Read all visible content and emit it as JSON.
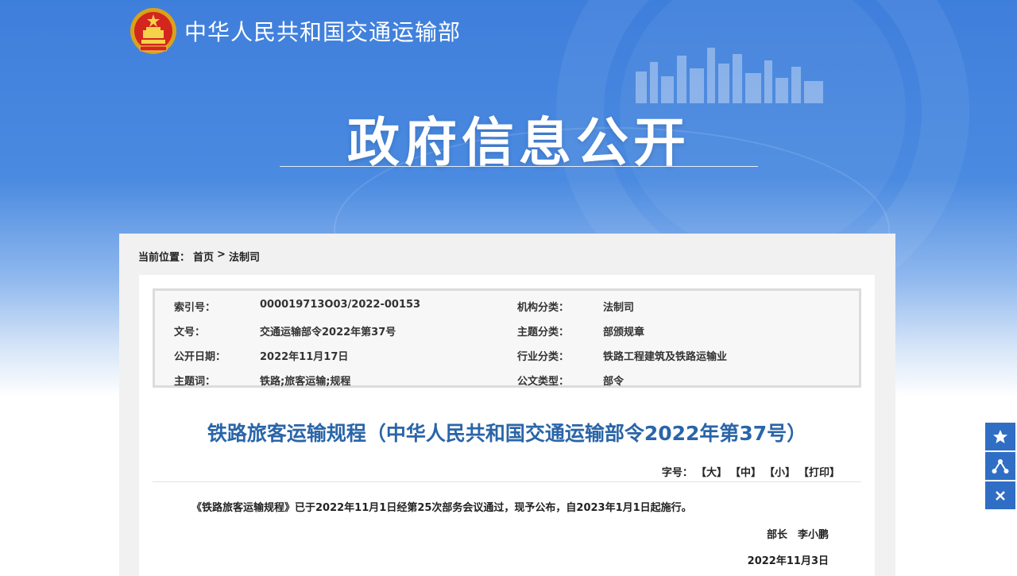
{
  "header": {
    "brand_name": "中华人民共和国交通运输部",
    "section_title": "政府信息公开"
  },
  "breadcrumb": {
    "prefix": "当前位置：",
    "items": [
      "首页",
      "法制司"
    ],
    "separator": ">"
  },
  "meta": {
    "rows": [
      {
        "k1": "索引号：",
        "v1": "000019713O03/2022-00153",
        "k2": "机构分类：",
        "v2": "法制司"
      },
      {
        "k1": "文号：",
        "v1": "交通运输部令2022年第37号",
        "k2": "主题分类：",
        "v2": "部颁规章"
      },
      {
        "k1": "公开日期：",
        "v1": "2022年11月17日",
        "k2": "行业分类：",
        "v2": "铁路工程建筑及铁路运输业"
      },
      {
        "k1": "主题词：",
        "v1": "铁路;旅客运输;规程",
        "k2": "公文类型：",
        "v2": "部令"
      }
    ]
  },
  "document": {
    "title": "铁路旅客运输规程（中华人民共和国交通运输部令2022年第37号）",
    "font_label": "字号：",
    "font_large": "【大】",
    "font_medium": "【中】",
    "font_small": "【小】",
    "print": "【打印】",
    "body": "《铁路旅客运输规程》已于2022年11月1日经第25次部务会议通过，现予公布，自2023年1月1日起施行。",
    "signer": "部长　李小鹏",
    "date": "2022年11月3日"
  },
  "side_tools": {
    "icons": [
      "star-icon",
      "share-icon",
      "close-icon"
    ]
  },
  "colors": {
    "hero_blue": "#3f7fdc",
    "title_blue": "#2a65a8",
    "tool_blue": "#2f6ec4"
  }
}
